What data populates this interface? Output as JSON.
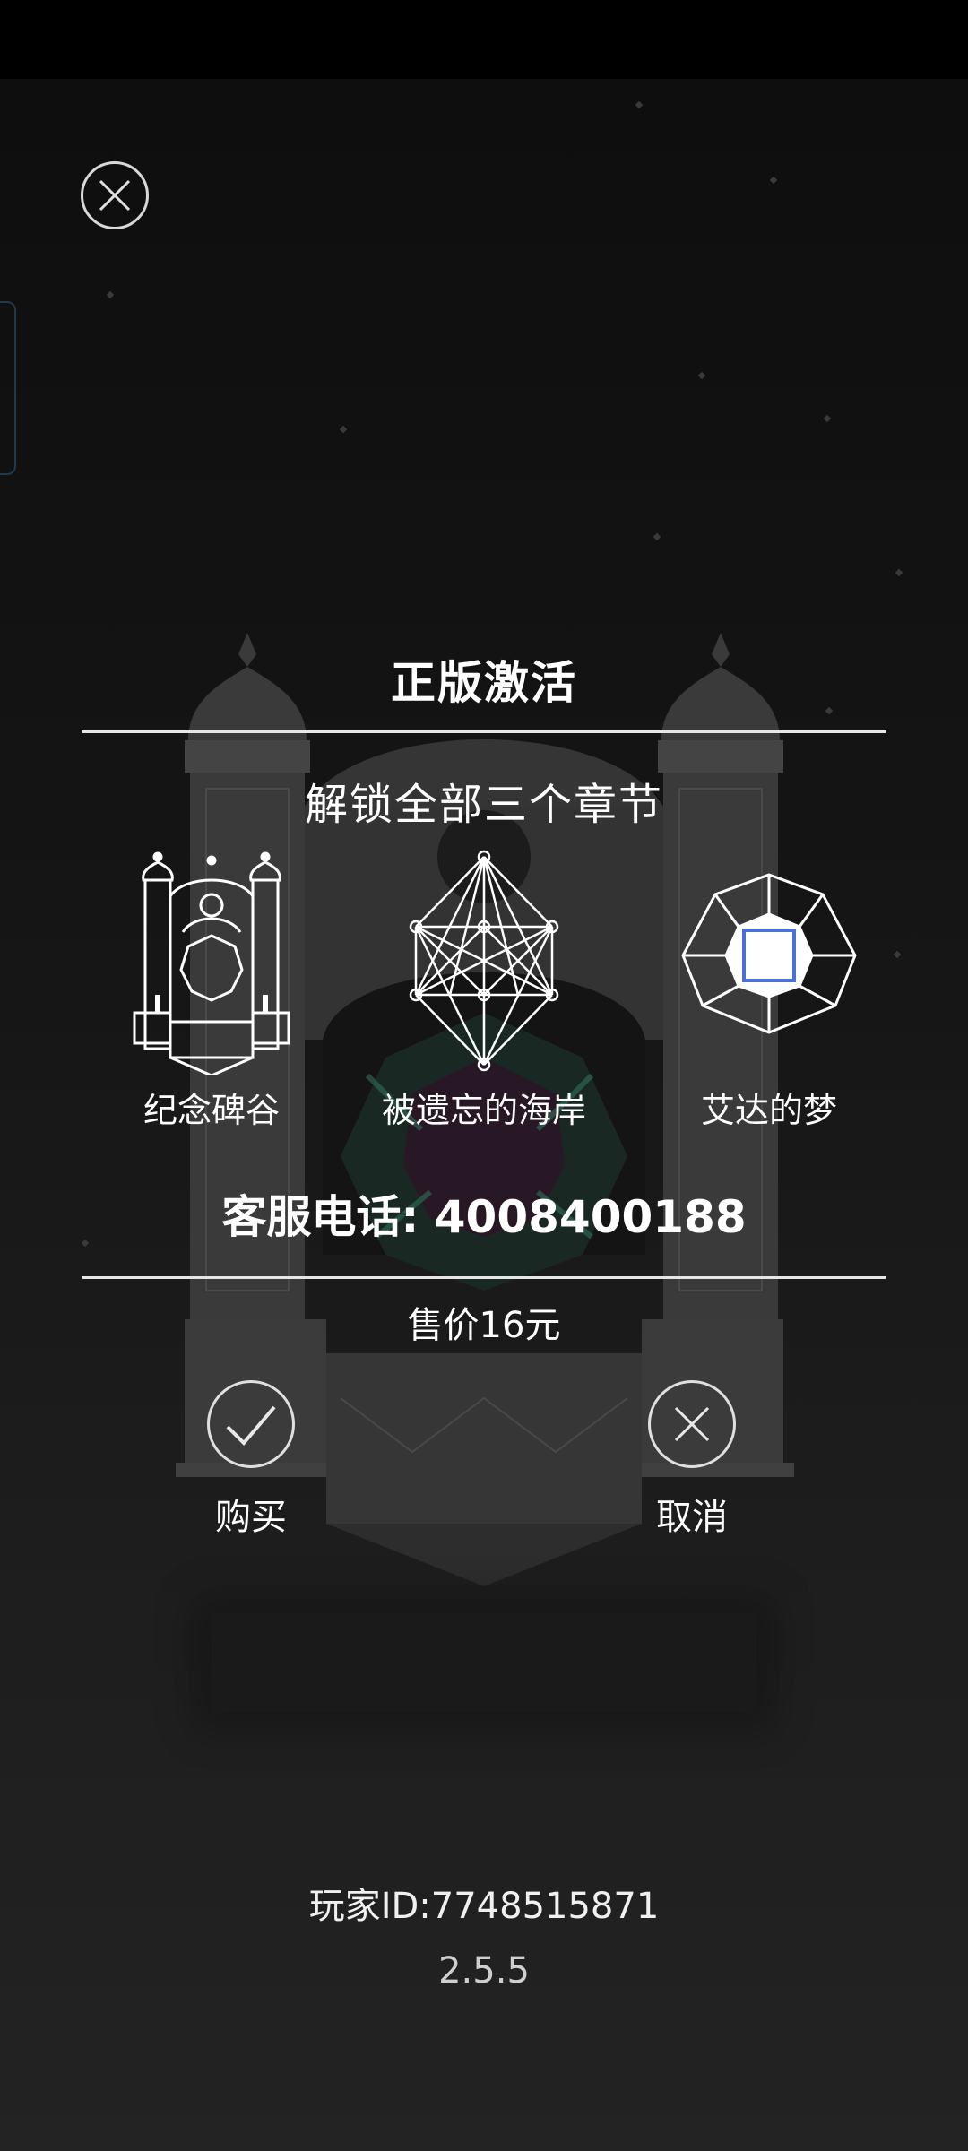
{
  "dialog": {
    "title": "正版激活",
    "subtitle": "解锁全部三个章节",
    "chapters": [
      {
        "label": "纪念碑谷",
        "icon": "monument-valley-temple-icon"
      },
      {
        "label": "被遗忘的海岸",
        "icon": "forgotten-shores-geometry-icon"
      },
      {
        "label": "艾达的梦",
        "icon": "idas-dream-octagon-icon"
      }
    ],
    "support_phone": "客服电话: 4008400188",
    "price": "售价16元",
    "buy_label": "购买",
    "cancel_label": "取消"
  },
  "footer": {
    "player_id": "玩家ID:7748515871",
    "version": "2.5.5"
  },
  "colors": {
    "background": "#161616",
    "text": "#ffffff",
    "accent_square": "#4a6fd8"
  }
}
